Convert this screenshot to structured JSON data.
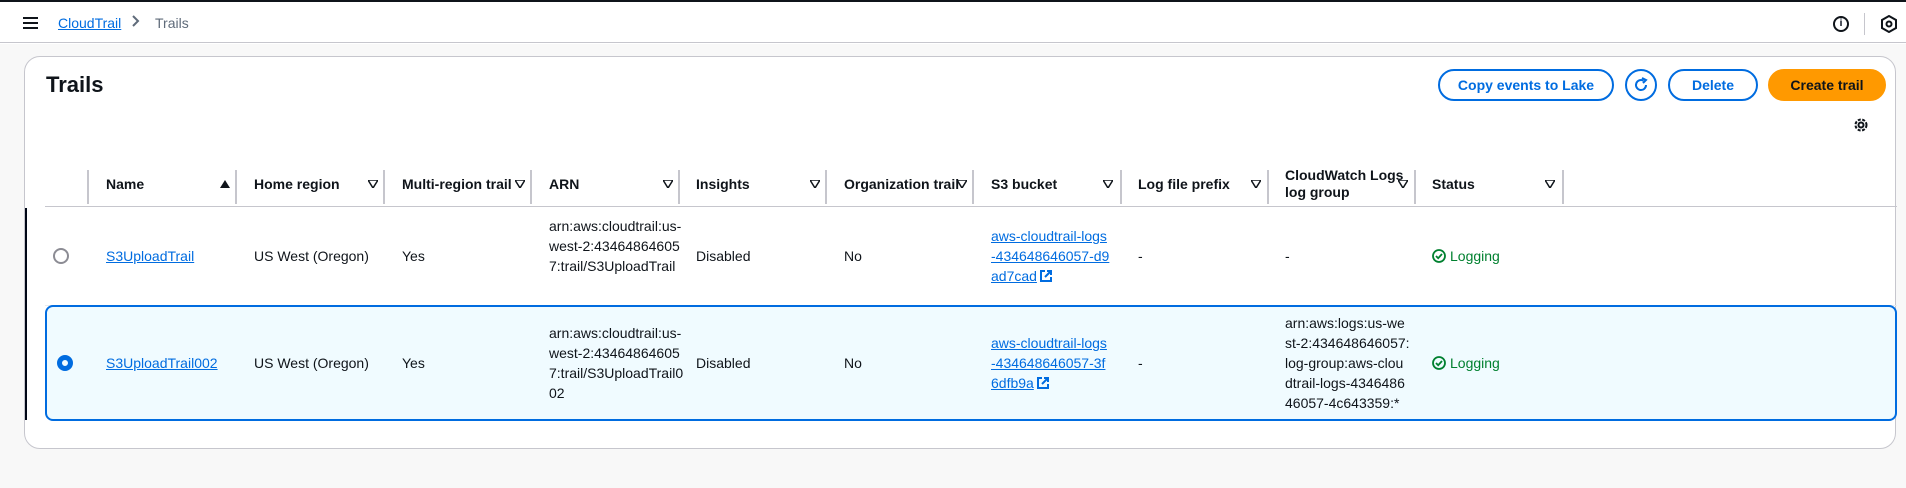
{
  "header": {
    "breadcrumb_root": "CloudTrail",
    "breadcrumb_separator": ">",
    "breadcrumb_current": "Trails"
  },
  "page": {
    "title": "Trails",
    "buttons": {
      "copy": "Copy events to Lake",
      "delete": "Delete",
      "create": "Create trail"
    }
  },
  "table": {
    "columns": [
      "Name",
      "Home region",
      "Multi-region trail",
      "ARN",
      "Insights",
      "Organization trail",
      "S3 bucket",
      "Log file prefix",
      "CloudWatch Logs log group",
      "Status"
    ],
    "rows": [
      {
        "selected": false,
        "name": "S3UploadTrail",
        "home_region": "US West (Oregon)",
        "multi_region": "Yes",
        "arn": "arn:aws:cloudtrail:us-west-2:434648646057:trail/S3UploadTrail",
        "insights": "Disabled",
        "org_trail": "No",
        "s3_bucket": "aws-cloudtrail-logs-434648646057-d9ad7cad",
        "log_prefix": "-",
        "cw_log_group": "-",
        "status": "Logging"
      },
      {
        "selected": true,
        "name": "S3UploadTrail002",
        "home_region": "US West (Oregon)",
        "multi_region": "Yes",
        "arn": "arn:aws:cloudtrail:us-west-2:434648646057:trail/S3UploadTrail002",
        "insights": "Disabled",
        "org_trail": "No",
        "s3_bucket": "aws-cloudtrail-logs-434648646057-3f6dfb9a",
        "log_prefix": "-",
        "cw_log_group": "arn:aws:logs:us-west-2:434648646057:log-group:aws-cloudtrail-logs-434648646057-4c643359:*",
        "status": "Logging"
      }
    ]
  },
  "colors": {
    "accent": "#006ce0",
    "primary_button": "#ff9900",
    "status_ok": "#00802f"
  }
}
